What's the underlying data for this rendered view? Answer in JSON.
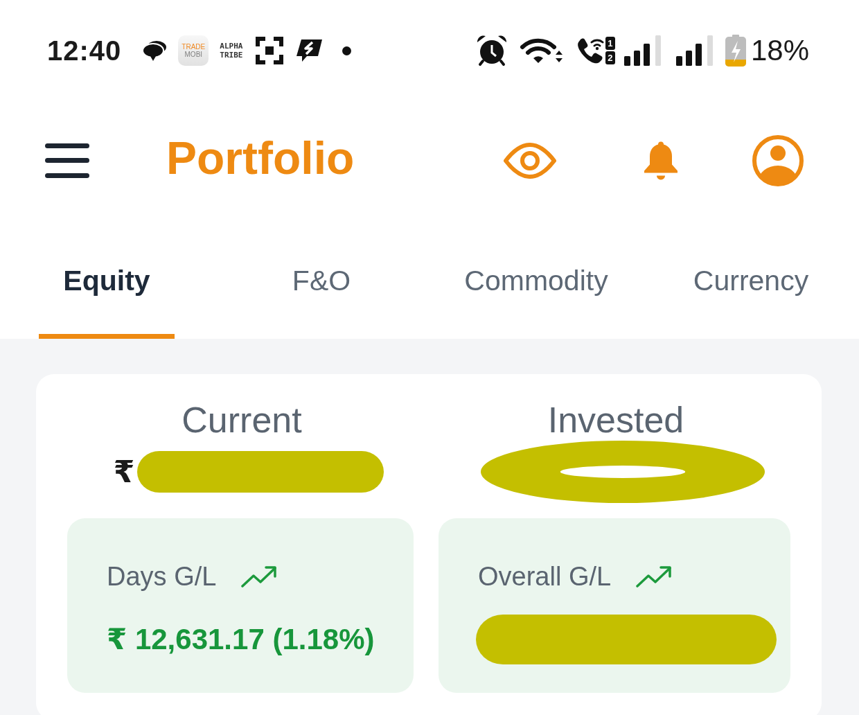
{
  "status_bar": {
    "time": "12:40",
    "app_logo_lines": [
      "TRADE",
      "MOBI"
    ],
    "notification_label": "ALPHA TRIBE",
    "sim_slots": [
      "1",
      "2"
    ],
    "battery": "18%"
  },
  "header": {
    "title": "Portfolio"
  },
  "tabs": [
    {
      "label": "Equity",
      "selected": true
    },
    {
      "label": "F&O",
      "selected": false
    },
    {
      "label": "Commodity",
      "selected": false
    },
    {
      "label": "Currency",
      "selected": false
    }
  ],
  "summary": [
    {
      "kind": "bar",
      "label": "Current",
      "value": "₹"
    },
    {
      "kind": "ring",
      "label": "Invested"
    }
  ],
  "gains": [
    {
      "label": "Days G/L",
      "rising": true,
      "value": "₹ 12,631.17 (1.18%)",
      "redacted": false
    },
    {
      "label": "Overall G/L",
      "rising": true,
      "redacted": true
    }
  ]
}
